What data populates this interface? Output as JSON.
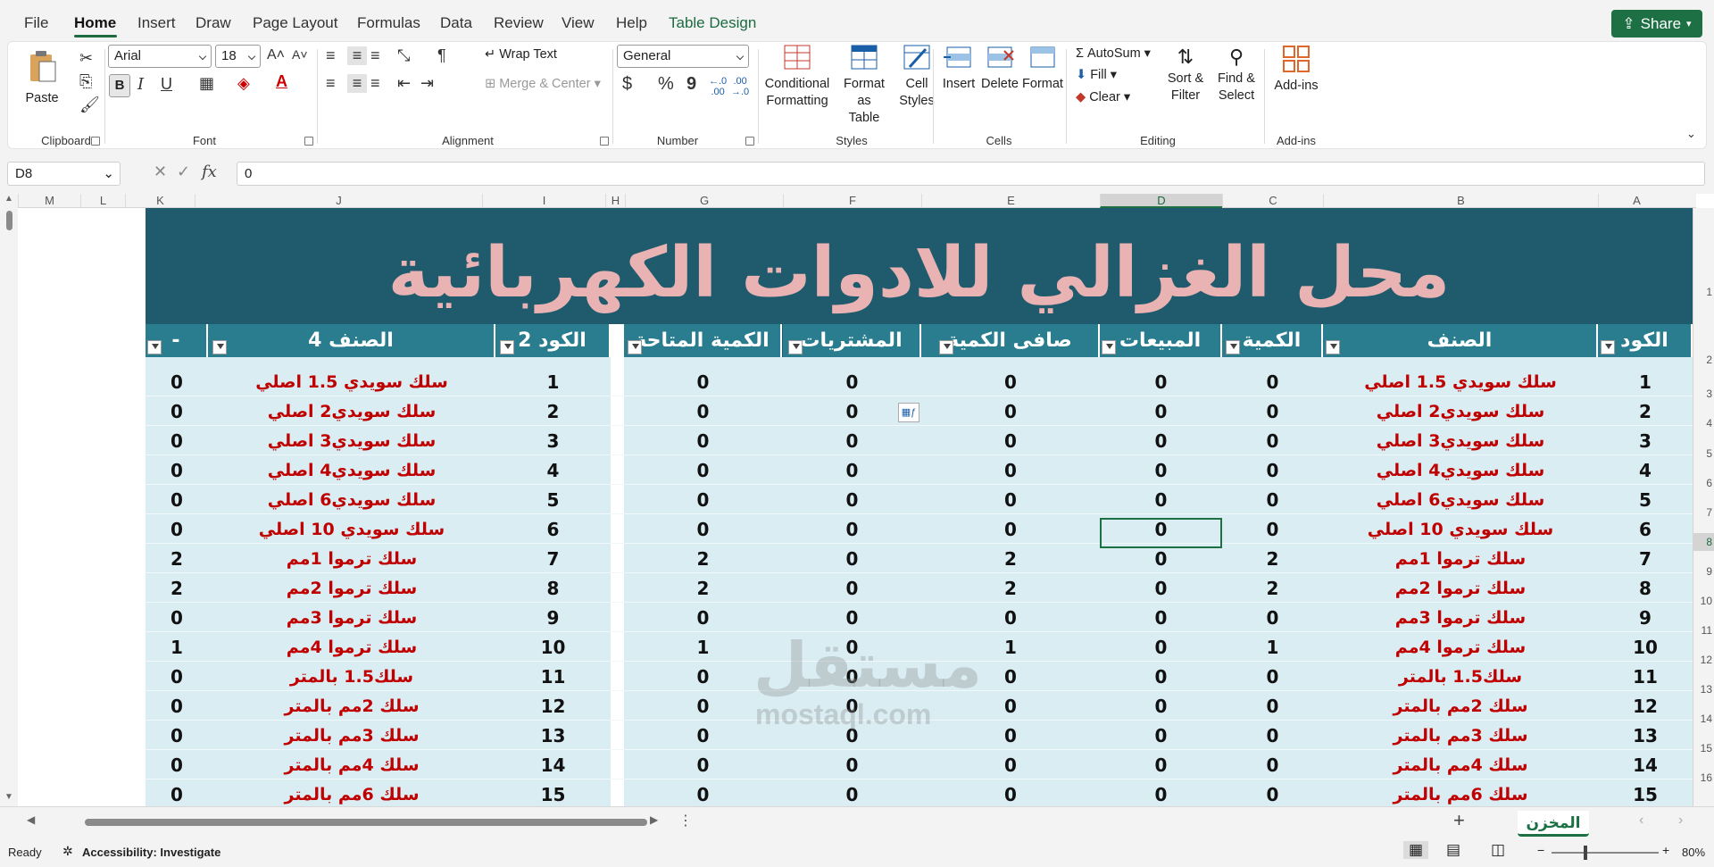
{
  "menu": {
    "tabs": [
      "File",
      "Home",
      "Insert",
      "Draw",
      "Page Layout",
      "Formulas",
      "Data",
      "Review",
      "View",
      "Help",
      "Table Design"
    ],
    "share": "Share"
  },
  "ribbon": {
    "clipboard": {
      "paste": "Paste",
      "label": "Clipboard"
    },
    "font": {
      "name": "Arial",
      "size": "18",
      "bold": "B",
      "italic": "I",
      "underline": "U",
      "label": "Font"
    },
    "alignment": {
      "wrap": "Wrap Text",
      "merge": "Merge & Center",
      "label": "Alignment"
    },
    "number": {
      "format": "General",
      "currency": "$",
      "percent": "%",
      "comma": "9",
      "label": "Number"
    },
    "styles": {
      "conditional": "Conditional",
      "conditional2": "Formatting",
      "format_table": "Format as",
      "format_table2": "Table",
      "cell_styles": "Cell",
      "cell_styles2": "Styles",
      "label": "Styles"
    },
    "cells": {
      "insert": "Insert",
      "delete": "Delete",
      "format": "Format",
      "label": "Cells"
    },
    "editing": {
      "autosum": "AutoSum",
      "fill": "Fill",
      "clear": "Clear",
      "sort": "Sort &",
      "sort2": "Filter",
      "find": "Find &",
      "find2": "Select",
      "label": "Editing"
    },
    "addins": {
      "addins": "Add-ins",
      "label": "Add-ins"
    }
  },
  "formula_bar": {
    "name_box": "D8",
    "fx": "fx",
    "value": "0"
  },
  "columns": [
    "M",
    "L",
    "K",
    "J",
    "I",
    "H",
    "G",
    "F",
    "E",
    "D",
    "C",
    "B",
    "A"
  ],
  "row_numbers": [
    "1",
    "2",
    "3",
    "4",
    "5",
    "6",
    "7",
    "8",
    "9",
    "10",
    "11",
    "12",
    "13",
    "14",
    "15",
    "16"
  ],
  "sheet_title": "محل الغزالي للادوات الكهربائية",
  "table_headers": {
    "code": "الكود",
    "item": "الصنف",
    "qty": "الكمية",
    "sales": "المبيعات",
    "net": "صافى الكمية",
    "purchases": "المشتريات",
    "available": "الكمية المتاحة",
    "code2": "الكود 2",
    "item4": "الصنف 4",
    "dash": "-"
  },
  "rows": [
    {
      "code": "1",
      "item": "سلك سويدي 1.5 اصلي",
      "qty": "0",
      "sales": "0",
      "net": "0",
      "purchases": "0",
      "available": "0",
      "code2": "1",
      "item4": "سلك سويدي 1.5 اصلي",
      "k": "0"
    },
    {
      "code": "2",
      "item": "سلك سويدي2 اصلي",
      "qty": "0",
      "sales": "0",
      "net": "0",
      "purchases": "0",
      "available": "0",
      "code2": "2",
      "item4": "سلك سويدي2 اصلي",
      "k": "0"
    },
    {
      "code": "3",
      "item": "سلك سويدي3 اصلي",
      "qty": "0",
      "sales": "0",
      "net": "0",
      "purchases": "0",
      "available": "0",
      "code2": "3",
      "item4": "سلك سويدي3 اصلي",
      "k": "0"
    },
    {
      "code": "4",
      "item": "سلك سويدي4 اصلي",
      "qty": "0",
      "sales": "0",
      "net": "0",
      "purchases": "0",
      "available": "0",
      "code2": "4",
      "item4": "سلك سويدي4 اصلي",
      "k": "0"
    },
    {
      "code": "5",
      "item": "سلك سويدي6 اصلي",
      "qty": "0",
      "sales": "0",
      "net": "0",
      "purchases": "0",
      "available": "0",
      "code2": "5",
      "item4": "سلك سويدي6 اصلي",
      "k": "0"
    },
    {
      "code": "6",
      "item": "سلك سويدي 10 اصلي",
      "qty": "0",
      "sales": "0",
      "net": "0",
      "purchases": "0",
      "available": "0",
      "code2": "6",
      "item4": "سلك سويدي 10 اصلي",
      "k": "0"
    },
    {
      "code": "7",
      "item": "سلك ترموا 1مم",
      "qty": "2",
      "sales": "0",
      "net": "2",
      "purchases": "0",
      "available": "2",
      "code2": "7",
      "item4": "سلك ترموا 1مم",
      "k": "2"
    },
    {
      "code": "8",
      "item": "سلك ترموا 2مم",
      "qty": "2",
      "sales": "0",
      "net": "2",
      "purchases": "0",
      "available": "2",
      "code2": "8",
      "item4": "سلك ترموا 2مم",
      "k": "2"
    },
    {
      "code": "9",
      "item": "سلك ترموا 3مم",
      "qty": "0",
      "sales": "0",
      "net": "0",
      "purchases": "0",
      "available": "0",
      "code2": "9",
      "item4": "سلك ترموا 3مم",
      "k": "0"
    },
    {
      "code": "10",
      "item": "سلك ترموا 4مم",
      "qty": "1",
      "sales": "0",
      "net": "1",
      "purchases": "0",
      "available": "1",
      "code2": "10",
      "item4": "سلك ترموا 4مم",
      "k": "1"
    },
    {
      "code": "11",
      "item": "سلك1.5 بالمتر",
      "qty": "0",
      "sales": "0",
      "net": "0",
      "purchases": "0",
      "available": "0",
      "code2": "11",
      "item4": "سلك1.5 بالمتر",
      "k": "0"
    },
    {
      "code": "12",
      "item": "سلك 2مم بالمتر",
      "qty": "0",
      "sales": "0",
      "net": "0",
      "purchases": "0",
      "available": "0",
      "code2": "12",
      "item4": "سلك 2مم بالمتر",
      "k": "0"
    },
    {
      "code": "13",
      "item": "سلك 3مم بالمتر",
      "qty": "0",
      "sales": "0",
      "net": "0",
      "purchases": "0",
      "available": "0",
      "code2": "13",
      "item4": "سلك 3مم بالمتر",
      "k": "0"
    },
    {
      "code": "14",
      "item": "سلك 4مم بالمتر",
      "qty": "0",
      "sales": "0",
      "net": "0",
      "purchases": "0",
      "available": "0",
      "code2": "14",
      "item4": "سلك 4مم بالمتر",
      "k": "0"
    },
    {
      "code": "15",
      "item": "سلك 6مم بالمتر",
      "qty": "0",
      "sales": "0",
      "net": "0",
      "purchases": "0",
      "available": "0",
      "code2": "15",
      "item4": "سلك 6مم بالمتر",
      "k": "0"
    }
  ],
  "watermark": {
    "arabic": "مستقل",
    "latin": "mostaql.com"
  },
  "sheet_tab": "المخزن",
  "status": {
    "ready": "Ready",
    "accessibility": "Accessibility: Investigate",
    "zoom": "80%"
  }
}
